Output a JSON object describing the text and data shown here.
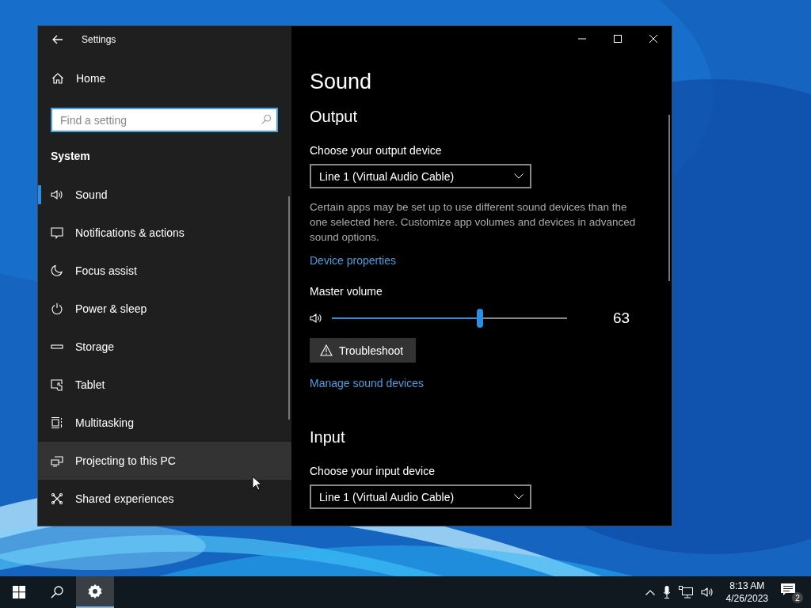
{
  "window": {
    "title": "Settings"
  },
  "sidebar": {
    "home": "Home",
    "search": {
      "placeholder": "Find a setting"
    },
    "section": "System",
    "items": [
      {
        "label": "Sound",
        "selected": true,
        "hovered": false
      },
      {
        "label": "Notifications & actions",
        "selected": false,
        "hovered": false
      },
      {
        "label": "Focus assist",
        "selected": false,
        "hovered": false
      },
      {
        "label": "Power & sleep",
        "selected": false,
        "hovered": false
      },
      {
        "label": "Storage",
        "selected": false,
        "hovered": false
      },
      {
        "label": "Tablet",
        "selected": false,
        "hovered": false
      },
      {
        "label": "Multitasking",
        "selected": false,
        "hovered": false
      },
      {
        "label": "Projecting to this PC",
        "selected": false,
        "hovered": true
      },
      {
        "label": "Shared experiences",
        "selected": false,
        "hovered": false
      }
    ]
  },
  "content": {
    "title": "Sound",
    "output": {
      "heading": "Output",
      "device_label": "Choose your output device",
      "device": "Line 1 (Virtual Audio Cable)",
      "note": "Certain apps may be set up to use different sound devices than the one selected here. Customize app volumes and devices in advanced sound options.",
      "properties_link": "Device properties",
      "volume_label": "Master volume",
      "volume": {
        "level": 0.63,
        "reading": "63"
      },
      "troubleshoot": "Troubleshoot",
      "manage_link": "Manage sound devices"
    },
    "input": {
      "heading": "Input",
      "device_label": "Choose your input device",
      "device": "Line 1 (Virtual Audio Cable)"
    }
  },
  "taskbar": {
    "time": "8:13 AM",
    "date": "4/26/2023",
    "notifications": "2"
  }
}
